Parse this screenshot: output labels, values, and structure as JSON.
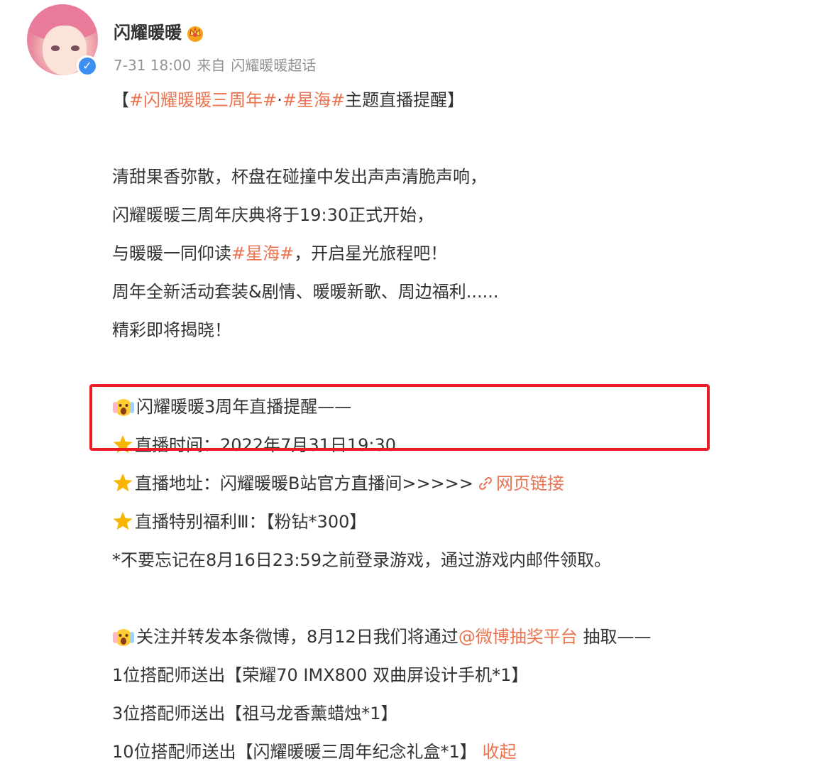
{
  "header": {
    "username": "闪耀暖暖",
    "time": "7-31 18:00",
    "from_label": "来自",
    "source": "闪耀暖暖超话"
  },
  "post": {
    "title": {
      "bracket_open": "【",
      "topic1": "#闪耀暖暖三周年#",
      "separator": "·",
      "topic2": "#星海#",
      "rest": "主题直播提醒",
      "bracket_close": "】"
    },
    "para1": [
      "清甜果香弥散，杯盘在碰撞中发出声声清脆声响，",
      "闪耀暖暖三周年庆典将于19:30正式开始，"
    ],
    "line3": {
      "before": "与暖暖一同仰读",
      "topic": "#星海#",
      "after": "，开启星光旅程吧！"
    },
    "para1_tail": [
      "周年全新活动套装&剧情、暖暖新歌、周边福利......",
      "精彩即将揭晓！"
    ],
    "reminder_heading": "闪耀暖暖3周年直播提醒——",
    "live_time": "直播时间：2022年7月31日19:30",
    "live_address": "直播地址：闪耀暖暖B站官方直播间>>>>>",
    "live_link": "网页链接",
    "live_welfare": "直播特别福利Ⅲ：【粉钻*300】",
    "note": "*不要忘记在8月16日23:59之前登录游戏，通过游戏内邮件领取。",
    "lottery": {
      "before": "关注并转发本条微博，8月12日我们将通过",
      "mention": "@微博抽奖平台",
      "after": " 抽取——"
    },
    "prizes": [
      "1位搭配师送出【荣耀70 IMX800 双曲屏设计手机*1】",
      "3位搭配师送出【祖马龙香薰蜡烛*1】"
    ],
    "last_prize": "10位搭配师送出【闪耀暖暖三周年纪念礼盒*1】",
    "collapse": "收起"
  },
  "colors": {
    "accent": "#eb7350",
    "highlight_border": "#ed1c24",
    "verified": "#3c8ef0",
    "star": "#f7b500"
  },
  "icons": [
    "avatar",
    "verified-icon",
    "crown-icon",
    "star-icon",
    "scream-emoji-icon",
    "link-icon"
  ]
}
